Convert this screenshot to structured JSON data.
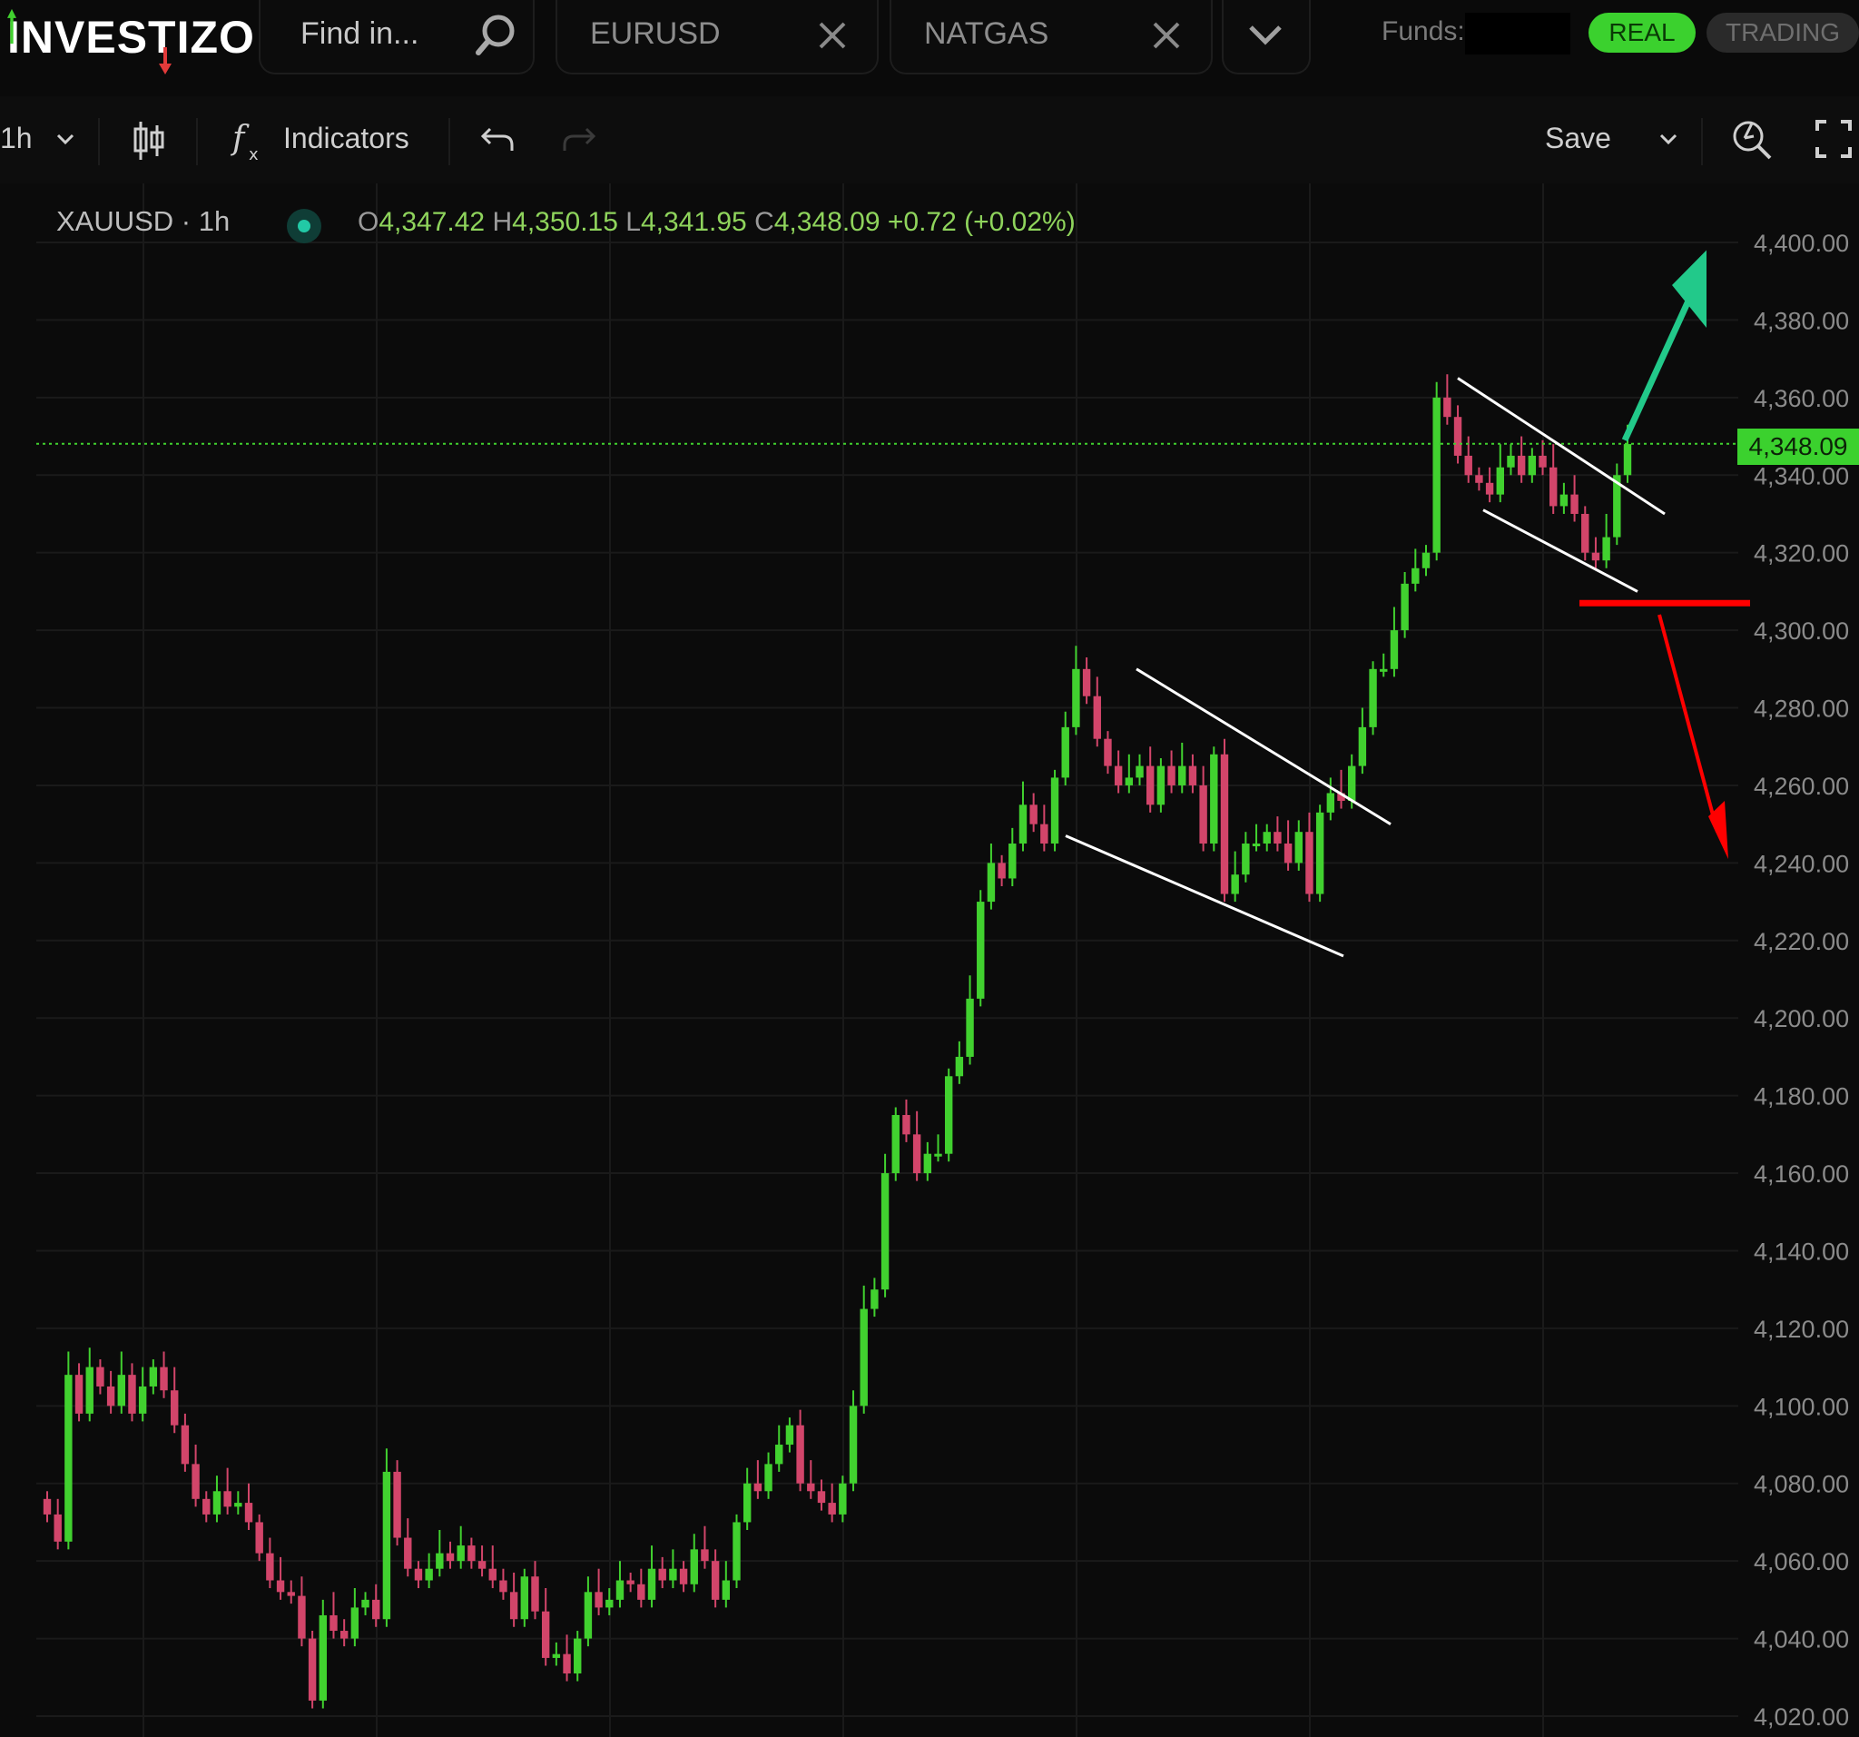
{
  "app": {
    "logo": "INVESTIZO",
    "search_placeholder": "Find in...",
    "tabs": [
      {
        "label": "EURUSD",
        "close_icon": "close-icon"
      },
      {
        "label": "NATGAS",
        "close_icon": "close-icon"
      }
    ],
    "funds_label": "Funds:",
    "account_modes": {
      "real": "REAL",
      "trading": "TRADING"
    }
  },
  "toolbar": {
    "interval": "1h",
    "indicators_label": "Indicators",
    "save_label": "Save"
  },
  "chart_header": {
    "symbol": "XAUUSD · 1h",
    "open_key": "O",
    "open": "4,347.42",
    "high_key": "H",
    "high": "4,350.15",
    "low_key": "L",
    "low": "4,341.95",
    "close_key": "C",
    "close": "4,348.09",
    "change": "+0.72 (+0.02%)"
  },
  "colors": {
    "up": "#41d12f",
    "down": "#d2456a",
    "accent_green": "#3bd12e",
    "arrow_up": "#22c98a",
    "arrow_down": "#ff0000",
    "trendline": "#ffffff"
  },
  "chart_data": {
    "type": "candlestick",
    "title": "",
    "xlabel": "",
    "ylabel": "",
    "ylim": [
      4015,
      4405
    ],
    "y_ticks": [
      "4,400.00",
      "4,380.00",
      "4,360.00",
      "4,340.00",
      "4,320.00",
      "4,300.00",
      "4,280.00",
      "4,260.00",
      "4,240.00",
      "4,220.00",
      "4,200.00",
      "4,180.00",
      "4,160.00",
      "4,140.00",
      "4,120.00",
      "4,100.00",
      "4,080.00",
      "4,060.00",
      "4,040.00",
      "4,020.00"
    ],
    "current_price": 4348.09,
    "current_price_label": "4,348.09",
    "close_series": [
      4072,
      4065,
      4108,
      4098,
      4110,
      4105,
      4100,
      4108,
      4098,
      4105,
      4110,
      4104,
      4095,
      4085,
      4076,
      4072,
      4078,
      4074,
      4075,
      4070,
      4062,
      4055,
      4052,
      4051,
      4040,
      4024,
      4046,
      4042,
      4040,
      4048,
      4050,
      4045,
      4083,
      4066,
      4058,
      4055,
      4058,
      4062,
      4060,
      4064,
      4060,
      4058,
      4055,
      4052,
      4045,
      4056,
      4047,
      4035,
      4036,
      4031,
      4040,
      4052,
      4048,
      4050,
      4055,
      4054,
      4050,
      4058,
      4055,
      4058,
      4054,
      4063,
      4060,
      4050,
      4055,
      4070,
      4080,
      4078,
      4085,
      4090,
      4095,
      4080,
      4078,
      4075,
      4072,
      4080,
      4100,
      4125,
      4130,
      4160,
      4175,
      4170,
      4160,
      4165,
      4165,
      4185,
      4190,
      4205,
      4230,
      4240,
      4236,
      4245,
      4255,
      4250,
      4245,
      4262,
      4275,
      4290,
      4283,
      4272,
      4265,
      4260,
      4262,
      4265,
      4255,
      4265,
      4260,
      4265,
      4260,
      4245,
      4268,
      4232,
      4237,
      4245,
      4245,
      4248,
      4245,
      4240,
      4248,
      4232,
      4253,
      4258,
      4256,
      4265,
      4275,
      4290,
      4290,
      4300,
      4312,
      4316,
      4320,
      4360,
      4355,
      4345,
      4340,
      4338,
      4335,
      4342,
      4345,
      4340,
      4345,
      4342,
      4332,
      4335,
      4330,
      4320,
      4318,
      4324,
      4340,
      4348
    ],
    "annotations": [
      {
        "type": "falling-wedge",
        "segments": [
          [
            4290,
            4250
          ],
          [
            4247,
            4216
          ]
        ]
      },
      {
        "type": "falling-wedge",
        "segments": [
          [
            4365,
            4330
          ],
          [
            4331,
            4310
          ]
        ]
      },
      {
        "type": "support-line",
        "price": 4307
      },
      {
        "type": "arrow-up",
        "target": 4395
      },
      {
        "type": "arrow-down",
        "target": 4240
      }
    ]
  }
}
